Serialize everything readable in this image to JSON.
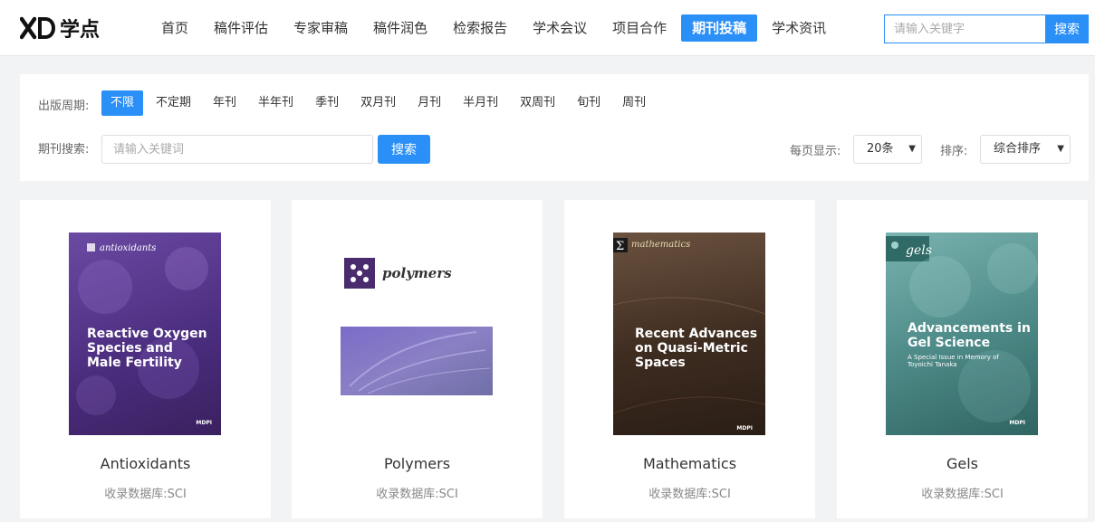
{
  "header": {
    "logo_text": "学点",
    "nav": [
      {
        "label": "首页",
        "active": false
      },
      {
        "label": "稿件评估",
        "active": false
      },
      {
        "label": "专家审稿",
        "active": false
      },
      {
        "label": "稿件润色",
        "active": false
      },
      {
        "label": "检索报告",
        "active": false
      },
      {
        "label": "学术会议",
        "active": false
      },
      {
        "label": "项目合作",
        "active": false
      },
      {
        "label": "期刊投稿",
        "active": true
      },
      {
        "label": "学术资讯",
        "active": false
      }
    ],
    "search": {
      "placeholder": "请输入关键字",
      "button_label": "搜索"
    }
  },
  "filter": {
    "frequency_label": "出版周期:",
    "frequencies": [
      {
        "label": "不限",
        "active": true
      },
      {
        "label": "不定期",
        "active": false
      },
      {
        "label": "年刊",
        "active": false
      },
      {
        "label": "半年刊",
        "active": false
      },
      {
        "label": "季刊",
        "active": false
      },
      {
        "label": "双月刊",
        "active": false
      },
      {
        "label": "月刊",
        "active": false
      },
      {
        "label": "半月刊",
        "active": false
      },
      {
        "label": "双周刊",
        "active": false
      },
      {
        "label": "旬刊",
        "active": false
      },
      {
        "label": "周刊",
        "active": false
      }
    ],
    "search_label": "期刊搜索:",
    "search_placeholder": "请输入关键词",
    "search_button": "搜索",
    "per_page_label": "每页显示:",
    "per_page_value": "20条",
    "sort_label": "排序:",
    "sort_value": "综合排序"
  },
  "journals": [
    {
      "name": "Antioxidants",
      "db_label": "收录数据库:",
      "db_value": "SCI",
      "cover": {
        "journal": "antioxidants",
        "title": [
          "Reactive Oxygen",
          "Species and",
          "Male Fertility"
        ],
        "subtitle": [],
        "color": "#5b3a8e"
      }
    },
    {
      "name": "Polymers",
      "db_label": "收录数据库:",
      "db_value": "SCI",
      "cover": {
        "journal": "polymers",
        "title": [],
        "subtitle": [],
        "color": "#5a3a88"
      }
    },
    {
      "name": "Mathematics",
      "db_label": "收录数据库:",
      "db_value": "SCI",
      "cover": {
        "journal": "mathematics",
        "title": [
          "Recent Advances",
          "on Quasi-Metric",
          "Spaces"
        ],
        "subtitle": [],
        "color": "#4a3526"
      }
    },
    {
      "name": "Gels",
      "db_label": "收录数据库:",
      "db_value": "SCI",
      "cover": {
        "journal": "gels",
        "title": [
          "Advancements in",
          "Gel Science"
        ],
        "subtitle": [
          "A Special Issue in Memory of",
          "Toyoichi Tanaka"
        ],
        "color": "#3d7a7a"
      }
    }
  ]
}
